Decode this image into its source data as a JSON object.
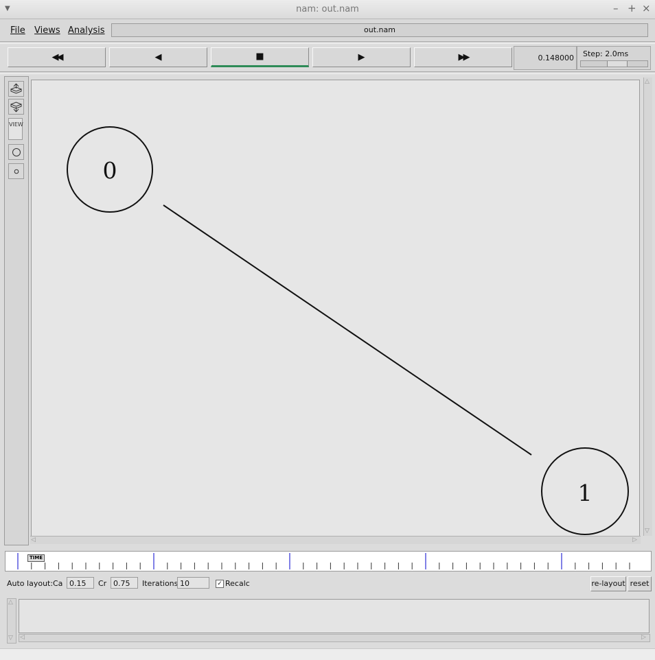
{
  "window": {
    "title": "nam: out.nam"
  },
  "menu": {
    "file": "File",
    "views": "Views",
    "analysis": "Analysis"
  },
  "file_name": "out.nam",
  "transport": {
    "buttons": [
      {
        "name": "rewind-icon",
        "glyph": "◀◀"
      },
      {
        "name": "backward-play-icon",
        "glyph": "◀"
      },
      {
        "name": "stop-icon",
        "glyph": "■"
      },
      {
        "name": "play-icon",
        "glyph": "▶"
      },
      {
        "name": "fast-forward-icon",
        "glyph": "▶▶"
      }
    ],
    "active": "stop",
    "time": "0.148000",
    "step_label": "Step: 2.0ms",
    "step_slider_level": 0.55
  },
  "left_toolbar": {
    "view_label": "VIEW"
  },
  "nodes": [
    {
      "id": "0",
      "label": "0"
    },
    {
      "id": "1",
      "label": "1"
    }
  ],
  "links": [
    {
      "from": "0",
      "to": "1"
    }
  ],
  "timeline": {
    "label": "TIME"
  },
  "autolayout": {
    "label": "Auto layout:",
    "ca_label": "Ca",
    "ca_value": "0.15",
    "cr_label": "Cr",
    "cr_value": "0.75",
    "iterations_label": "Iterations",
    "iterations_value": "10",
    "recalc_label": "Recalc",
    "recalc_checked": true,
    "relayout_button": "re-layout",
    "reset_button": "reset"
  },
  "colors": {
    "active_underline": "#2e8b57",
    "timeline_major_tick": "#0000cc"
  }
}
